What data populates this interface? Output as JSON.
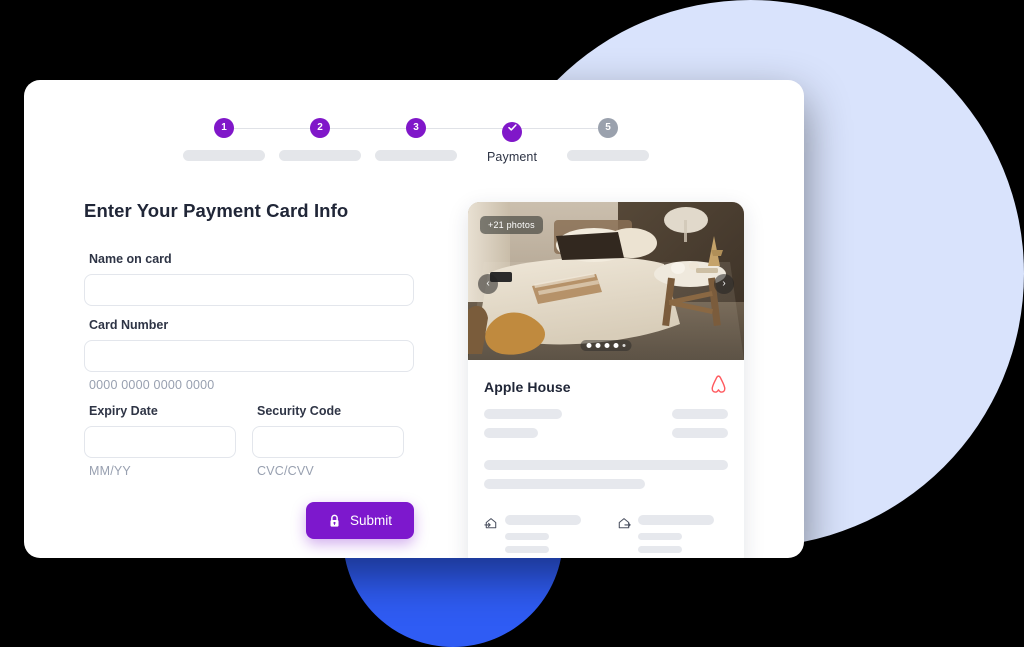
{
  "theme": {
    "accent_purple": "#8017c9",
    "submit_purple": "#7d18cd",
    "bg_circle_light": "#d9e3fc",
    "bg_circle_blue": "#2f5cf4",
    "airbnb_red": "#ff5a5f",
    "step_inactive_gray": "#9aa1ad",
    "skeleton_gray": "#e6e8ed"
  },
  "stepper": {
    "steps": [
      {
        "number": "1",
        "label": "",
        "state": "done",
        "icon": ""
      },
      {
        "number": "2",
        "label": "",
        "state": "done",
        "icon": ""
      },
      {
        "number": "3",
        "label": "",
        "state": "done",
        "icon": ""
      },
      {
        "number": "",
        "label": "Payment",
        "state": "current",
        "icon": "check-icon"
      },
      {
        "number": "5",
        "label": "",
        "state": "upcoming",
        "icon": ""
      }
    ]
  },
  "form": {
    "title": "Enter Your Payment Card Info",
    "name_on_card": {
      "label": "Name on card",
      "value": "",
      "placeholder": ""
    },
    "card_number": {
      "label": "Card Number",
      "value": "",
      "placeholder": "",
      "hint": "0000 0000 0000 0000"
    },
    "expiry_date": {
      "label": "Expiry Date",
      "value": "",
      "placeholder": "",
      "hint": "MM/YY"
    },
    "security_code": {
      "label": "Security Code",
      "value": "",
      "placeholder": "",
      "hint": "CVC/CVV"
    },
    "submit": {
      "label": "Submit",
      "icon": "lock-icon"
    }
  },
  "listing": {
    "photo": {
      "badge": "+21 photos",
      "prev_icon": "chevron-left-icon",
      "next_icon": "chevron-right-icon",
      "dots_count": 4
    },
    "title": "Apple House",
    "brand_icon": "airbnb-logo-icon",
    "check_in_icon": "check-in-house-icon",
    "check_out_icon": "check-out-house-icon"
  }
}
